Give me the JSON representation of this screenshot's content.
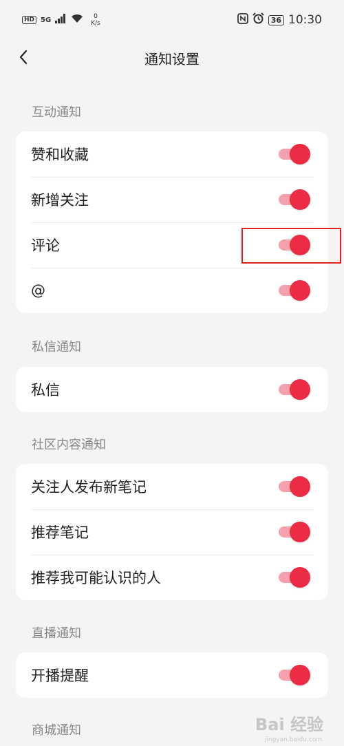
{
  "status_bar": {
    "hd": "HD",
    "signal": "5G",
    "net_speed_value": "0",
    "net_speed_unit": "K/s",
    "battery": "36",
    "time": "10:30"
  },
  "header": {
    "title": "通知设置"
  },
  "sections": [
    {
      "label": "互动通知",
      "items": [
        {
          "label": "赞和收藏",
          "enabled": true
        },
        {
          "label": "新增关注",
          "enabled": true
        },
        {
          "label": "评论",
          "enabled": true
        },
        {
          "label": "@",
          "enabled": true
        }
      ]
    },
    {
      "label": "私信通知",
      "items": [
        {
          "label": "私信",
          "enabled": true
        }
      ]
    },
    {
      "label": "社区内容通知",
      "items": [
        {
          "label": "关注人发布新笔记",
          "enabled": true
        },
        {
          "label": "推荐笔记",
          "enabled": true
        },
        {
          "label": "推荐我可能认识的人",
          "enabled": true
        }
      ]
    },
    {
      "label": "直播通知",
      "items": [
        {
          "label": "开播提醒",
          "enabled": true
        }
      ]
    },
    {
      "label": "商城通知",
      "items": []
    }
  ],
  "colors": {
    "toggle_on_thumb": "#ec2b45",
    "toggle_on_track": "#f5a0ad",
    "highlight": "#e02020",
    "background": "#f4f4f4"
  },
  "watermark": {
    "text": "Bai 经验",
    "sub": "jingyan.baidu.com"
  }
}
